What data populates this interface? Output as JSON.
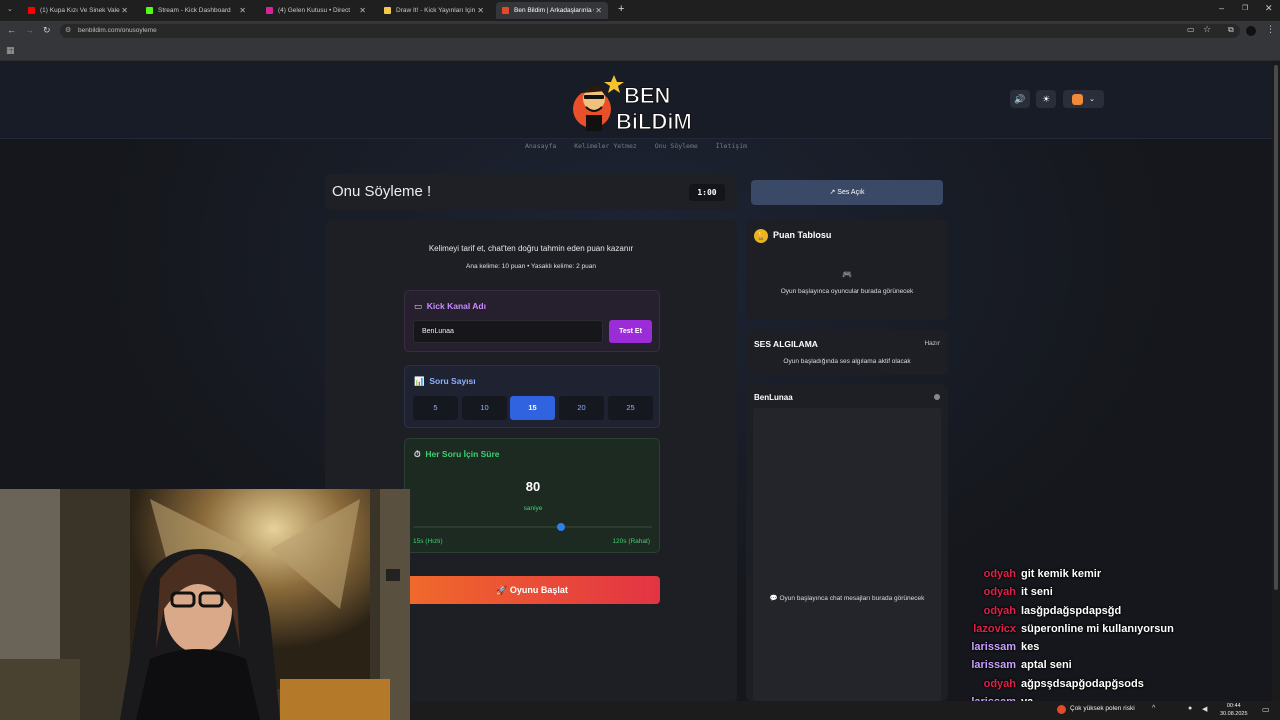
{
  "browser": {
    "tabs": [
      {
        "title": "(1) Kupa Kızı Ve Sinek Vale...",
        "icon_color": "#ff0000",
        "active": false
      },
      {
        "title": "Stream - Kick Dashboard",
        "icon_color": "#53fc18",
        "active": false
      },
      {
        "title": "(4) Gelen Kutusu • Direct",
        "icon_color": "#d6249f",
        "active": false
      },
      {
        "title": "Draw It! - Kick Yayınları İçin",
        "icon_color": "#f2c94c",
        "active": false
      },
      {
        "title": "Ben Bildim | Arkadaşlarınla Onl...",
        "icon_color": "#e24a2a",
        "active": true
      }
    ],
    "new_tab": "+",
    "url": "benbildim.com/onusoyleme"
  },
  "header": {
    "logo_line1": "BEN",
    "logo_line2": "BiLDiM",
    "sound_icon": "speaker-icon",
    "theme_icon": "sun-icon"
  },
  "nav": {
    "items": [
      "Anasayfa",
      "Kelimeler Yetmez",
      "Onu Söyleme",
      "İletişim"
    ]
  },
  "game": {
    "title": "Onu Söyleme !",
    "timer": "1:00",
    "description": "Kelimeyi tarif et, chat'ten doğru tahmin eden puan kazanır",
    "points": "Ana kelime: 10 puan • Yasaklı kelime: 2 puan",
    "kick": {
      "title": "Kick Kanal Adı",
      "value": "BenLunaa",
      "test_button": "Test Et"
    },
    "count": {
      "title": "Soru Sayısı",
      "options": [
        "5",
        "10",
        "15",
        "20",
        "25"
      ],
      "selected": "15"
    },
    "time": {
      "title": "Her Soru İçin Süre",
      "value": "80",
      "unit": "saniye",
      "min_label": "15s (Hızlı)",
      "max_label": "120s (Rahat)",
      "slider_fraction": 0.62
    },
    "start_button": "Oyunu Başlat"
  },
  "sidebar": {
    "sound_button": "Ses Açık",
    "scoreboard": {
      "title": "Puan Tablosu",
      "empty": "Oyun başlayınca oyuncular burada görünecek"
    },
    "voice": {
      "title": "SES ALGILAMA",
      "status": "Hazır",
      "desc": "Oyun başladığında ses algılama aktif olacak"
    },
    "chat": {
      "title": "BenLunaa",
      "empty": "Oyun başlayınca chat mesajları burada görünecek"
    }
  },
  "stream_chat": [
    {
      "user": "odyah",
      "color": "#e0204a",
      "message": "git kemik kemir"
    },
    {
      "user": "odyah",
      "color": "#e0204a",
      "message": "it seni"
    },
    {
      "user": "odyah",
      "color": "#e0204a",
      "message": "lasğpdağspdapsğd"
    },
    {
      "user": "lazovicx",
      "color": "#e0204a",
      "message": "süperonline mi kullanıyorsun"
    },
    {
      "user": "larissam",
      "color": "#c9a0ff",
      "message": "kes"
    },
    {
      "user": "larissam",
      "color": "#c9a0ff",
      "message": "aptal seni"
    },
    {
      "user": "odyah",
      "color": "#e0204a",
      "message": "ağpsşdsapğodapğsods"
    },
    {
      "user": "larissam",
      "color": "#c9a0ff",
      "message": "ya"
    }
  ],
  "taskbar": {
    "pollen": "Çok yüksek polen riski",
    "time": "00:44",
    "date": "30.08.2025"
  }
}
